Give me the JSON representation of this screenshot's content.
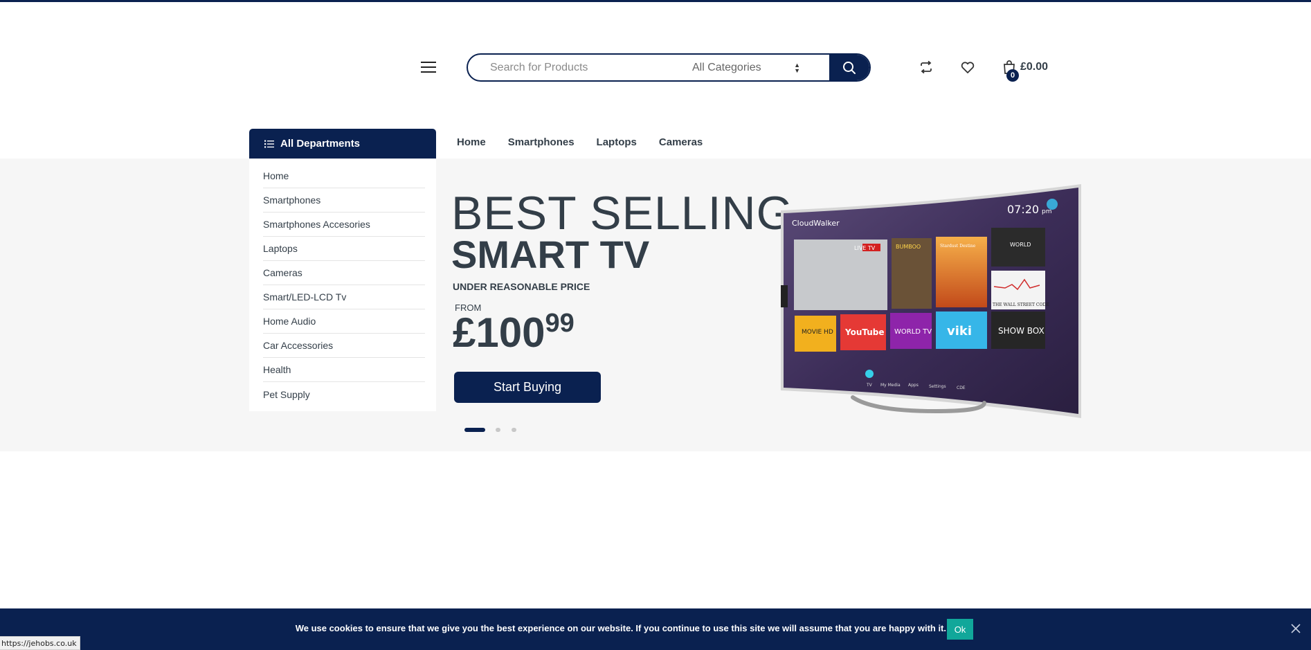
{
  "header": {
    "search_placeholder": "Search for Products",
    "category_selected": "All Categories",
    "cart": {
      "count": "0",
      "total": "£0.00"
    }
  },
  "departments": {
    "title": "All Departments",
    "items": [
      {
        "label": "Home"
      },
      {
        "label": "Smartphones"
      },
      {
        "label": "Smartphones Accesories"
      },
      {
        "label": "Laptops"
      },
      {
        "label": "Cameras"
      },
      {
        "label": "Smart/LED-LCD Tv"
      },
      {
        "label": "Home Audio"
      },
      {
        "label": "Car Accessories"
      },
      {
        "label": "Health"
      },
      {
        "label": "Pet Supply"
      }
    ]
  },
  "nav": {
    "items": [
      {
        "label": "Home"
      },
      {
        "label": "Smartphones"
      },
      {
        "label": "Laptops"
      },
      {
        "label": "Cameras"
      }
    ]
  },
  "slider": {
    "line1": "BEST SELLING",
    "line2": "SMART TV",
    "subtitle": "UNDER REASONABLE PRICE",
    "from_label": "FROM",
    "price_main": "£100",
    "price_cents": "99",
    "cta": "Start Buying",
    "active_slide": 1,
    "slide_count": 3
  },
  "tv_screen": {
    "brand": "CloudWalker",
    "time": "07:20",
    "period": "pm",
    "tiles": [
      "LIVE TV",
      "BUMBOO",
      "Stardust Destine",
      "WORLD",
      "THE WALL STREET CODE",
      "MOVIE HD",
      "YouTube",
      "WORLD TV",
      "viki",
      "SHOW BOX"
    ],
    "dock": [
      "TV",
      "My Media",
      "Apps",
      "Settings",
      "CDE"
    ]
  },
  "cookie": {
    "message": "We use cookies to ensure that we give you the best experience on our website. If you continue to use this site we will assume that you are happy with it.",
    "ok": "Ok"
  },
  "status_bar": {
    "url": "https://jehobs.co.uk"
  },
  "colors": {
    "brand_navy": "#0a2150",
    "ok_teal": "#11a79a",
    "hero_bg": "#f6f6f6",
    "text": "#333e48"
  }
}
